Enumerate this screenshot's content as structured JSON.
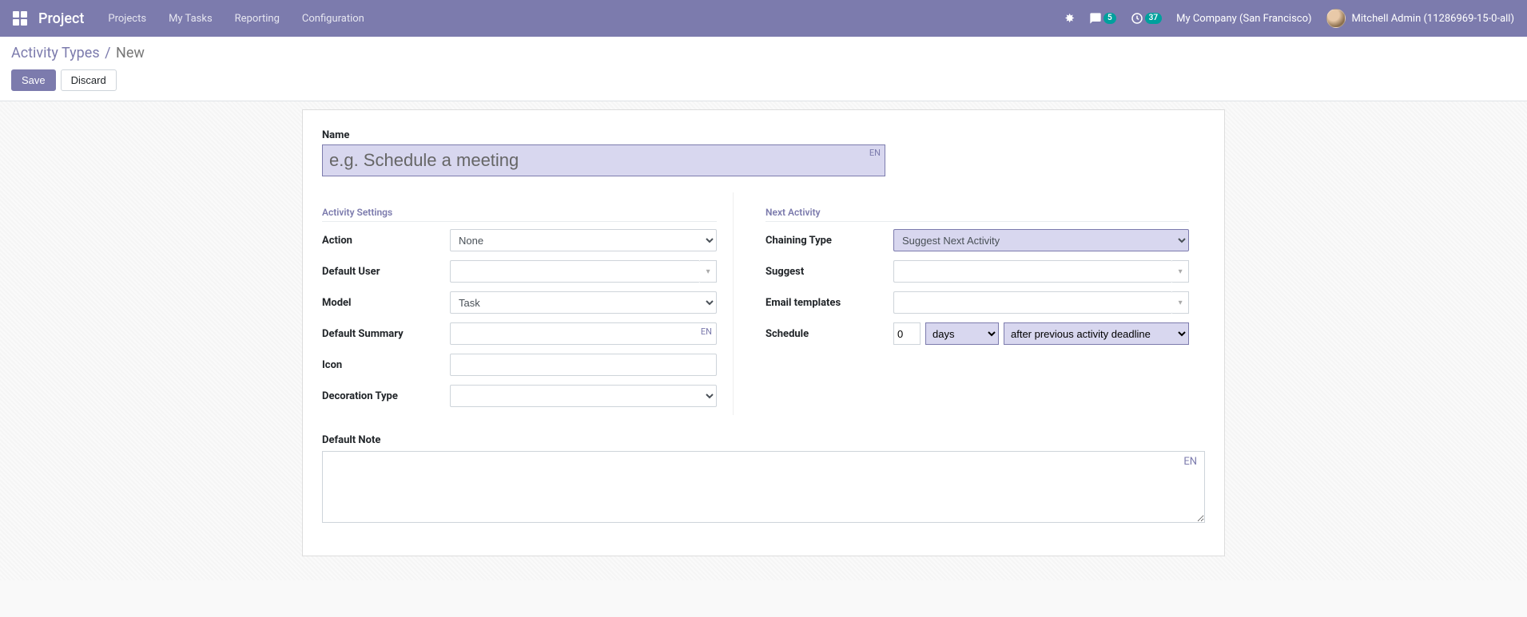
{
  "nav": {
    "brand": "Project",
    "menu": [
      "Projects",
      "My Tasks",
      "Reporting",
      "Configuration"
    ],
    "msg_badge": "5",
    "act_badge": "37",
    "company": "My Company (San Francisco)",
    "user": "Mitchell Admin (11286969-15-0-all)"
  },
  "breadcrumb": {
    "parent": "Activity Types",
    "current": "New"
  },
  "buttons": {
    "save": "Save",
    "discard": "Discard"
  },
  "form": {
    "name_label": "Name",
    "name_placeholder": "e.g. Schedule a meeting",
    "lang": "EN",
    "activity_settings_title": "Activity Settings",
    "next_activity_title": "Next Activity",
    "labels": {
      "action": "Action",
      "default_user": "Default User",
      "model": "Model",
      "default_summary": "Default Summary",
      "icon": "Icon",
      "decoration_type": "Decoration Type",
      "chaining_type": "Chaining Type",
      "suggest": "Suggest",
      "email_templates": "Email templates",
      "schedule": "Schedule",
      "default_note": "Default Note"
    },
    "action_value": "None",
    "model_value": "Task",
    "chaining_value": "Suggest Next Activity",
    "schedule_count": "0",
    "schedule_unit": "days",
    "schedule_from": "after previous activity deadline"
  }
}
